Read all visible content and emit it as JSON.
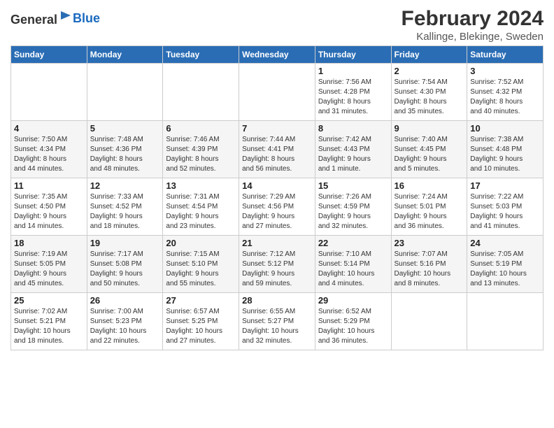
{
  "header": {
    "logo_general": "General",
    "logo_blue": "Blue",
    "title": "February 2024",
    "subtitle": "Kallinge, Blekinge, Sweden"
  },
  "weekdays": [
    "Sunday",
    "Monday",
    "Tuesday",
    "Wednesday",
    "Thursday",
    "Friday",
    "Saturday"
  ],
  "weeks": [
    [
      {
        "day": "",
        "info": ""
      },
      {
        "day": "",
        "info": ""
      },
      {
        "day": "",
        "info": ""
      },
      {
        "day": "",
        "info": ""
      },
      {
        "day": "1",
        "info": "Sunrise: 7:56 AM\nSunset: 4:28 PM\nDaylight: 8 hours\nand 31 minutes."
      },
      {
        "day": "2",
        "info": "Sunrise: 7:54 AM\nSunset: 4:30 PM\nDaylight: 8 hours\nand 35 minutes."
      },
      {
        "day": "3",
        "info": "Sunrise: 7:52 AM\nSunset: 4:32 PM\nDaylight: 8 hours\nand 40 minutes."
      }
    ],
    [
      {
        "day": "4",
        "info": "Sunrise: 7:50 AM\nSunset: 4:34 PM\nDaylight: 8 hours\nand 44 minutes."
      },
      {
        "day": "5",
        "info": "Sunrise: 7:48 AM\nSunset: 4:36 PM\nDaylight: 8 hours\nand 48 minutes."
      },
      {
        "day": "6",
        "info": "Sunrise: 7:46 AM\nSunset: 4:39 PM\nDaylight: 8 hours\nand 52 minutes."
      },
      {
        "day": "7",
        "info": "Sunrise: 7:44 AM\nSunset: 4:41 PM\nDaylight: 8 hours\nand 56 minutes."
      },
      {
        "day": "8",
        "info": "Sunrise: 7:42 AM\nSunset: 4:43 PM\nDaylight: 9 hours\nand 1 minute."
      },
      {
        "day": "9",
        "info": "Sunrise: 7:40 AM\nSunset: 4:45 PM\nDaylight: 9 hours\nand 5 minutes."
      },
      {
        "day": "10",
        "info": "Sunrise: 7:38 AM\nSunset: 4:48 PM\nDaylight: 9 hours\nand 10 minutes."
      }
    ],
    [
      {
        "day": "11",
        "info": "Sunrise: 7:35 AM\nSunset: 4:50 PM\nDaylight: 9 hours\nand 14 minutes."
      },
      {
        "day": "12",
        "info": "Sunrise: 7:33 AM\nSunset: 4:52 PM\nDaylight: 9 hours\nand 18 minutes."
      },
      {
        "day": "13",
        "info": "Sunrise: 7:31 AM\nSunset: 4:54 PM\nDaylight: 9 hours\nand 23 minutes."
      },
      {
        "day": "14",
        "info": "Sunrise: 7:29 AM\nSunset: 4:56 PM\nDaylight: 9 hours\nand 27 minutes."
      },
      {
        "day": "15",
        "info": "Sunrise: 7:26 AM\nSunset: 4:59 PM\nDaylight: 9 hours\nand 32 minutes."
      },
      {
        "day": "16",
        "info": "Sunrise: 7:24 AM\nSunset: 5:01 PM\nDaylight: 9 hours\nand 36 minutes."
      },
      {
        "day": "17",
        "info": "Sunrise: 7:22 AM\nSunset: 5:03 PM\nDaylight: 9 hours\nand 41 minutes."
      }
    ],
    [
      {
        "day": "18",
        "info": "Sunrise: 7:19 AM\nSunset: 5:05 PM\nDaylight: 9 hours\nand 45 minutes."
      },
      {
        "day": "19",
        "info": "Sunrise: 7:17 AM\nSunset: 5:08 PM\nDaylight: 9 hours\nand 50 minutes."
      },
      {
        "day": "20",
        "info": "Sunrise: 7:15 AM\nSunset: 5:10 PM\nDaylight: 9 hours\nand 55 minutes."
      },
      {
        "day": "21",
        "info": "Sunrise: 7:12 AM\nSunset: 5:12 PM\nDaylight: 9 hours\nand 59 minutes."
      },
      {
        "day": "22",
        "info": "Sunrise: 7:10 AM\nSunset: 5:14 PM\nDaylight: 10 hours\nand 4 minutes."
      },
      {
        "day": "23",
        "info": "Sunrise: 7:07 AM\nSunset: 5:16 PM\nDaylight: 10 hours\nand 8 minutes."
      },
      {
        "day": "24",
        "info": "Sunrise: 7:05 AM\nSunset: 5:19 PM\nDaylight: 10 hours\nand 13 minutes."
      }
    ],
    [
      {
        "day": "25",
        "info": "Sunrise: 7:02 AM\nSunset: 5:21 PM\nDaylight: 10 hours\nand 18 minutes."
      },
      {
        "day": "26",
        "info": "Sunrise: 7:00 AM\nSunset: 5:23 PM\nDaylight: 10 hours\nand 22 minutes."
      },
      {
        "day": "27",
        "info": "Sunrise: 6:57 AM\nSunset: 5:25 PM\nDaylight: 10 hours\nand 27 minutes."
      },
      {
        "day": "28",
        "info": "Sunrise: 6:55 AM\nSunset: 5:27 PM\nDaylight: 10 hours\nand 32 minutes."
      },
      {
        "day": "29",
        "info": "Sunrise: 6:52 AM\nSunset: 5:29 PM\nDaylight: 10 hours\nand 36 minutes."
      },
      {
        "day": "",
        "info": ""
      },
      {
        "day": "",
        "info": ""
      }
    ]
  ]
}
